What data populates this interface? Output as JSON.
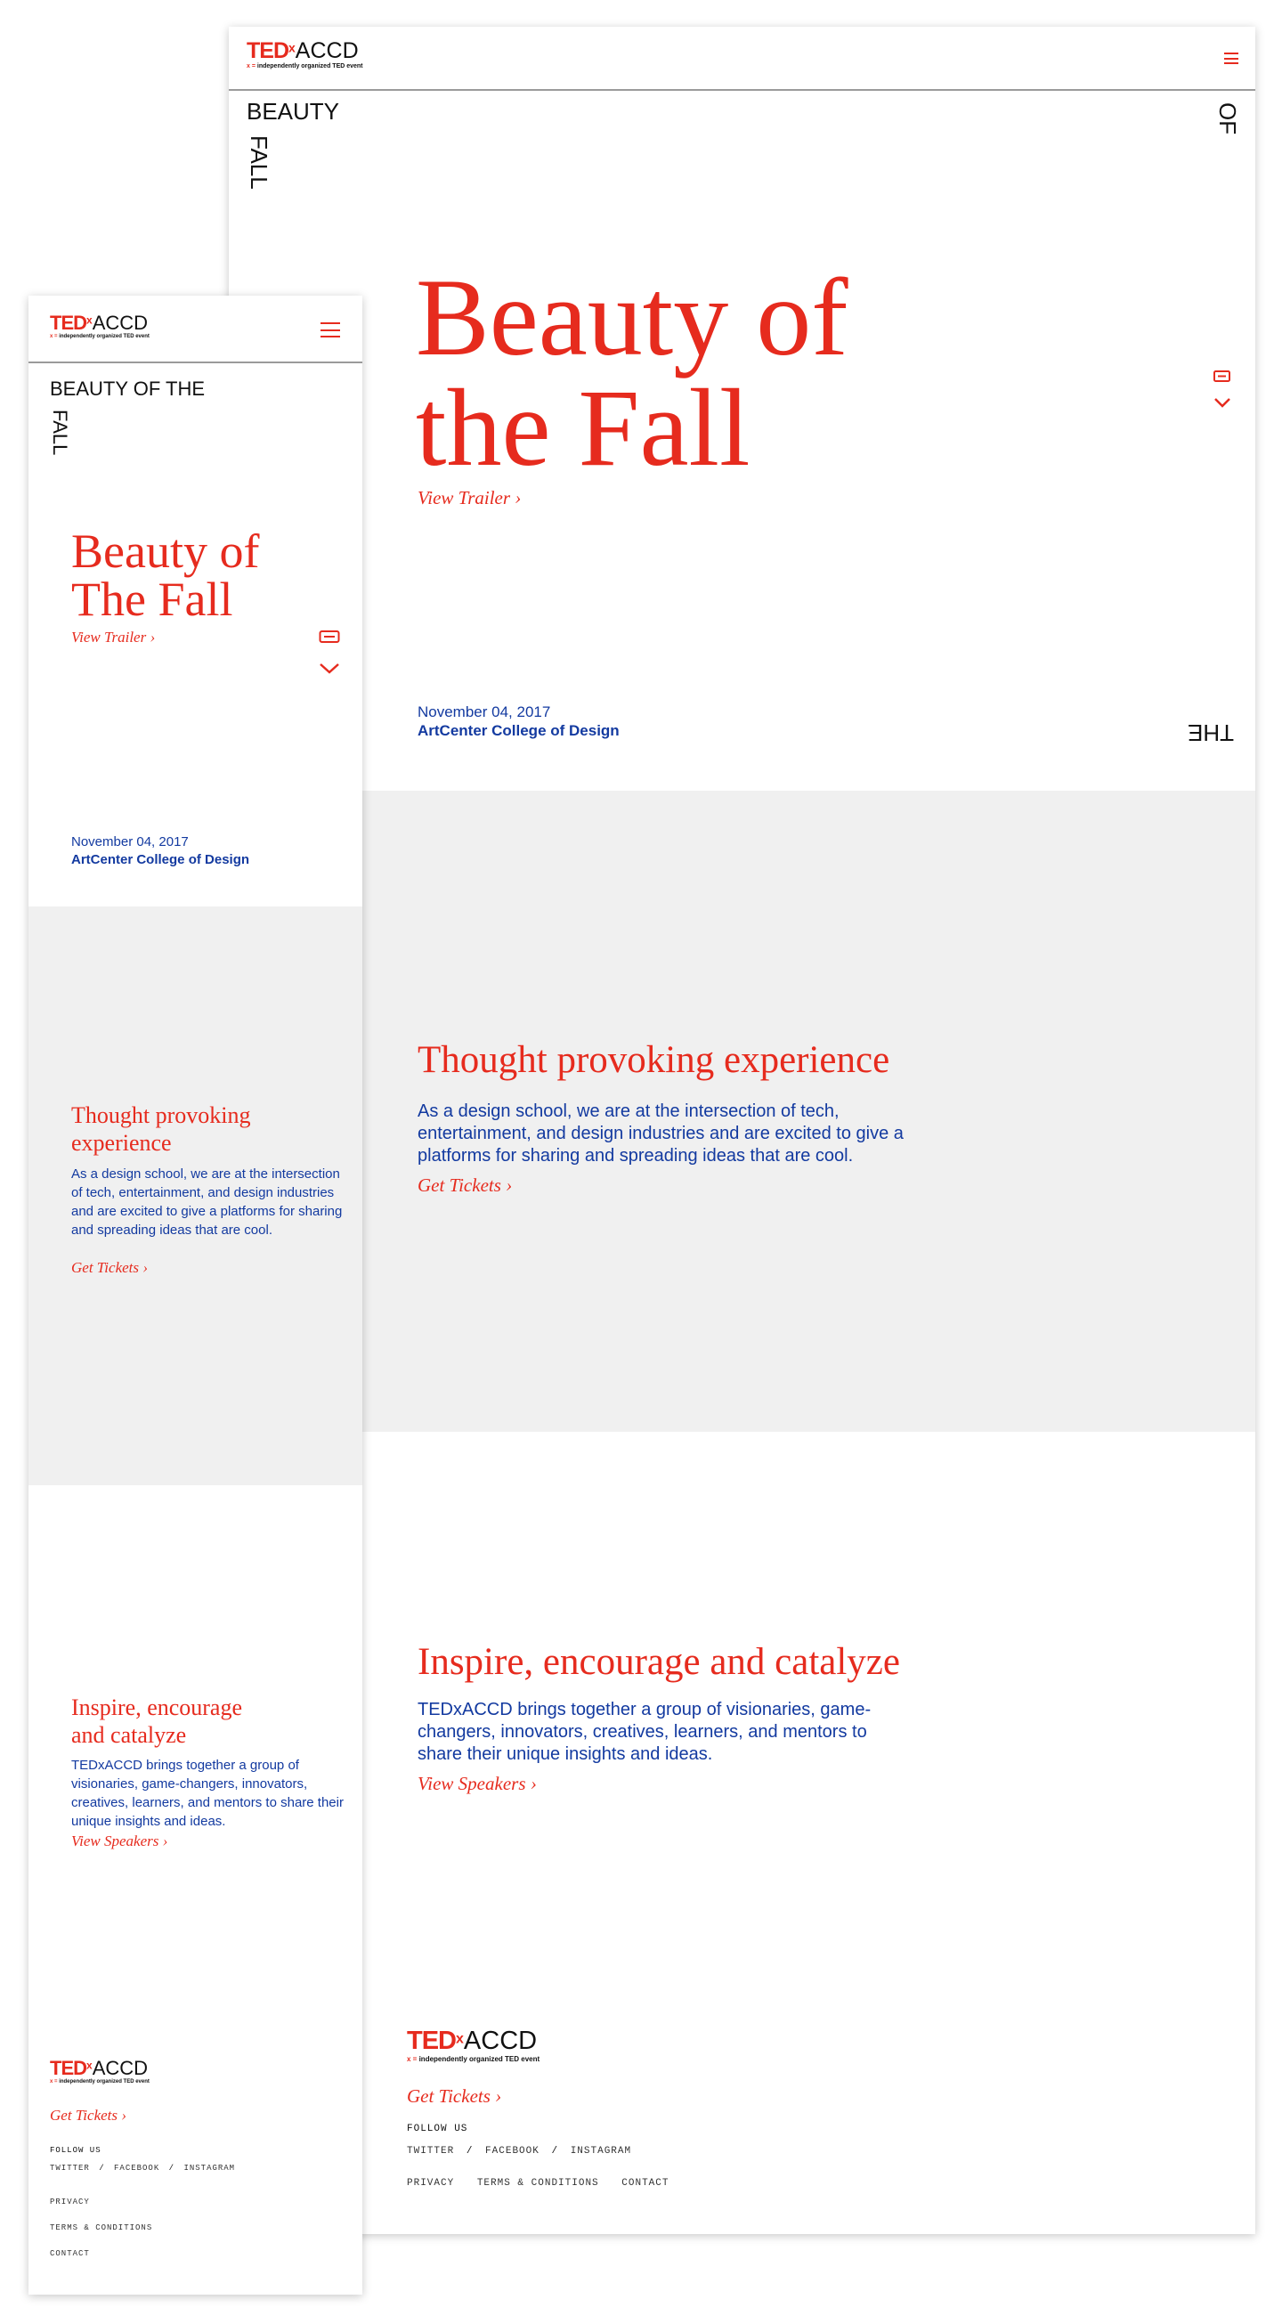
{
  "brand": {
    "ted": "TED",
    "x": "x",
    "accd": "ACCD",
    "tag_mark": "x =",
    "tagline": "independently organized TED event"
  },
  "hero": {
    "corner_words": [
      "BEAUTY",
      "FALL",
      "OF",
      "THE"
    ],
    "mobile_corner_top": "BEAUTY OF THE",
    "mobile_corner_side": "FALL",
    "title_desktop_line1": "Beauty of",
    "title_desktop_line2": "the Fall",
    "title_mobile_line1": "Beauty of",
    "title_mobile_line2": "The Fall",
    "trailer_link": "View Trailer ›",
    "date": "November 04, 2017",
    "venue": "ArtCenter College of Design"
  },
  "section_experience": {
    "heading": "Thought provoking experience",
    "mobile_heading_line1": "Thought provoking",
    "mobile_heading_line2": "experience",
    "body": "As a design school, we are at the intersection of tech, entertainment, and design industries and are excited to give a platforms for sharing and spreading ideas that are cool.",
    "link": "Get Tickets ›"
  },
  "section_inspire": {
    "heading": "Inspire, encourage and catalyze",
    "mobile_heading_line1": "Inspire, encourage",
    "mobile_heading_line2": "and catalyze",
    "body": "TEDxACCD brings together a group of visionaries, game-changers, innovators, creatives, learners, and mentors to share their unique insights and ideas.",
    "link": "View Speakers ›"
  },
  "footer": {
    "tickets_link": "Get Tickets ›",
    "follow_label": "FOLLOW US",
    "social": [
      "TWITTER",
      "FACEBOOK",
      "INSTAGRAM"
    ],
    "social_sep": "/",
    "legal": [
      "PRIVACY",
      "TERMS & CONDITIONS",
      "CONTACT"
    ]
  },
  "icons": {
    "menu": "menu-icon",
    "ticket": "ticket-icon",
    "chevron": "chevron-down-icon"
  },
  "colors": {
    "accent_red": "#e62b1e",
    "text_blue": "#133aa0",
    "section_gray": "#f0f0f0"
  }
}
